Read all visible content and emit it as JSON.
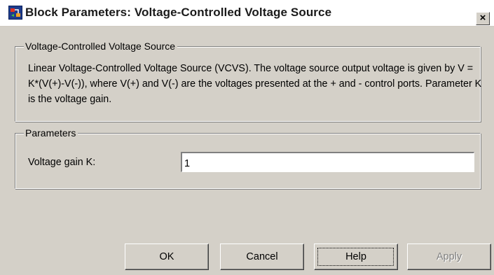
{
  "window": {
    "title": "Block Parameters: Voltage-Controlled Voltage Source",
    "icon": "simulink-block-icon",
    "close_label": "×"
  },
  "description_group": {
    "legend": "Voltage-Controlled Voltage Source",
    "text": "Linear Voltage-Controlled Voltage Source (VCVS). The voltage source output voltage is given by V = K*(V(+)-V(-)), where V(+) and V(-) are the voltages presented at the + and - control ports. Parameter K is the voltage gain."
  },
  "parameters_group": {
    "legend": "Parameters",
    "fields": [
      {
        "label": "Voltage gain K:",
        "value": "1"
      }
    ]
  },
  "buttons": {
    "ok": "OK",
    "cancel": "Cancel",
    "help": "Help",
    "apply": "Apply"
  },
  "colors": {
    "dialog_face": "#d4d0c8",
    "disabled_text": "#808080"
  }
}
